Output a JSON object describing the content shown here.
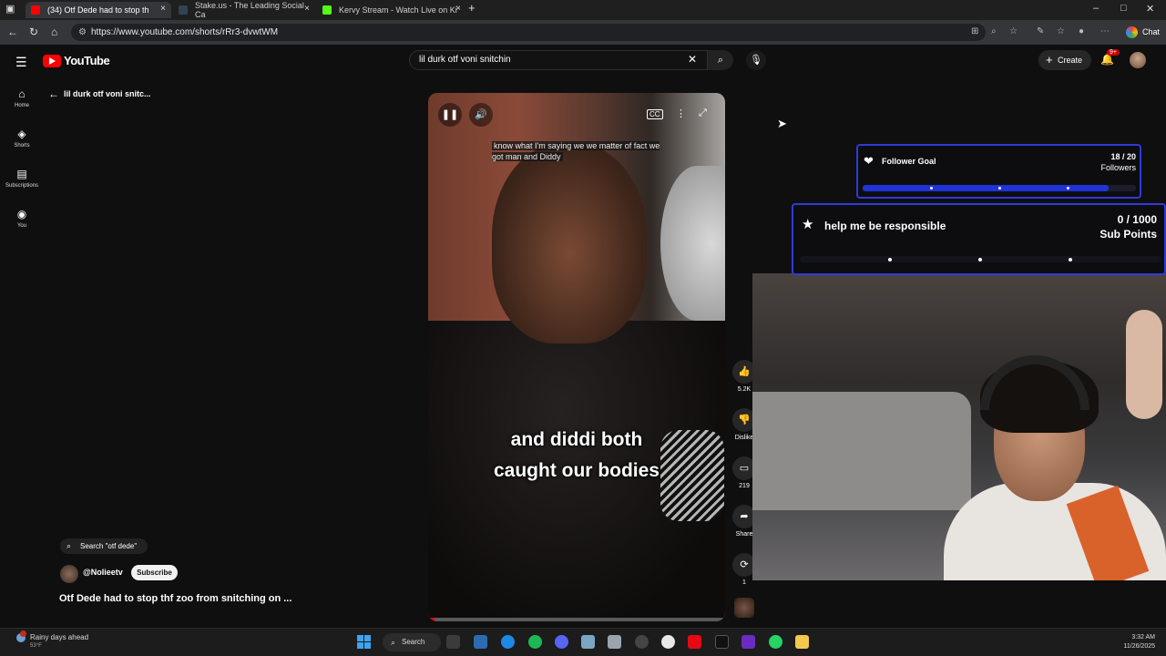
{
  "browser": {
    "tabs": [
      {
        "label": "(34) Otf Dede had to stop th",
        "active": true
      },
      {
        "label": "Stake.us - The Leading Social Ca",
        "active": false
      },
      {
        "label": "Kervy Stream - Watch Live on Ki",
        "active": false
      }
    ],
    "new_tab": "+",
    "window_controls": {
      "minimize": "–",
      "maximize": "□",
      "close": "✕"
    },
    "url": "https://www.youtube.com/shorts/rRr3-dvwtWM",
    "chat_label": "Chat"
  },
  "youtube": {
    "logo_text": "YouTube",
    "search_value": "lil durk otf voni snitchin",
    "create_label": "Create",
    "notification_count": "9+",
    "guide": [
      {
        "icon": "home-icon",
        "label": "Home"
      },
      {
        "icon": "shorts-icon",
        "label": "Shorts"
      },
      {
        "icon": "subscriptions-icon",
        "label": "Subscriptions"
      },
      {
        "icon": "you-icon",
        "label": "You"
      }
    ],
    "shorts_query": "lil durk otf voni snitc...",
    "search_chip": "Search \"otf dede\"",
    "channel_name": "@Nolieetv",
    "subscribe_label": "Subscribe",
    "video_title": "Otf Dede had to stop thf zoo from snitching on ...",
    "top_caption": "know what I'm saying we we matter of fact we got man and Diddy",
    "burned_subtitle_line1": "and diddi both",
    "burned_subtitle_line2": "caught our bodies",
    "cc_label": "CC",
    "progress_fraction": 0.02,
    "actions": {
      "like_count": "5.2K",
      "dislike_label": "Dislike",
      "comment_count": "219",
      "share_label": "Share",
      "remix_count": "1"
    }
  },
  "overlay": {
    "follower_goal": {
      "title": "Follower Goal",
      "count": "18 / 20",
      "unit": "Followers",
      "current": 18,
      "target": 20
    },
    "sub_goal": {
      "title": "help me be responsible",
      "count": "0 / 1000",
      "unit": "Sub Points",
      "current": 0,
      "target": 1000
    }
  },
  "taskbar": {
    "weather_text": "Rainy days ahead",
    "weather_temp": "53°F",
    "search_label": "Search",
    "time": "3:32 AM",
    "date": "11/26/2025"
  },
  "colors": {
    "youtube_red": "#ff0000",
    "goal_border": "#2e3bd8",
    "goal_fill": "#2033d6"
  }
}
